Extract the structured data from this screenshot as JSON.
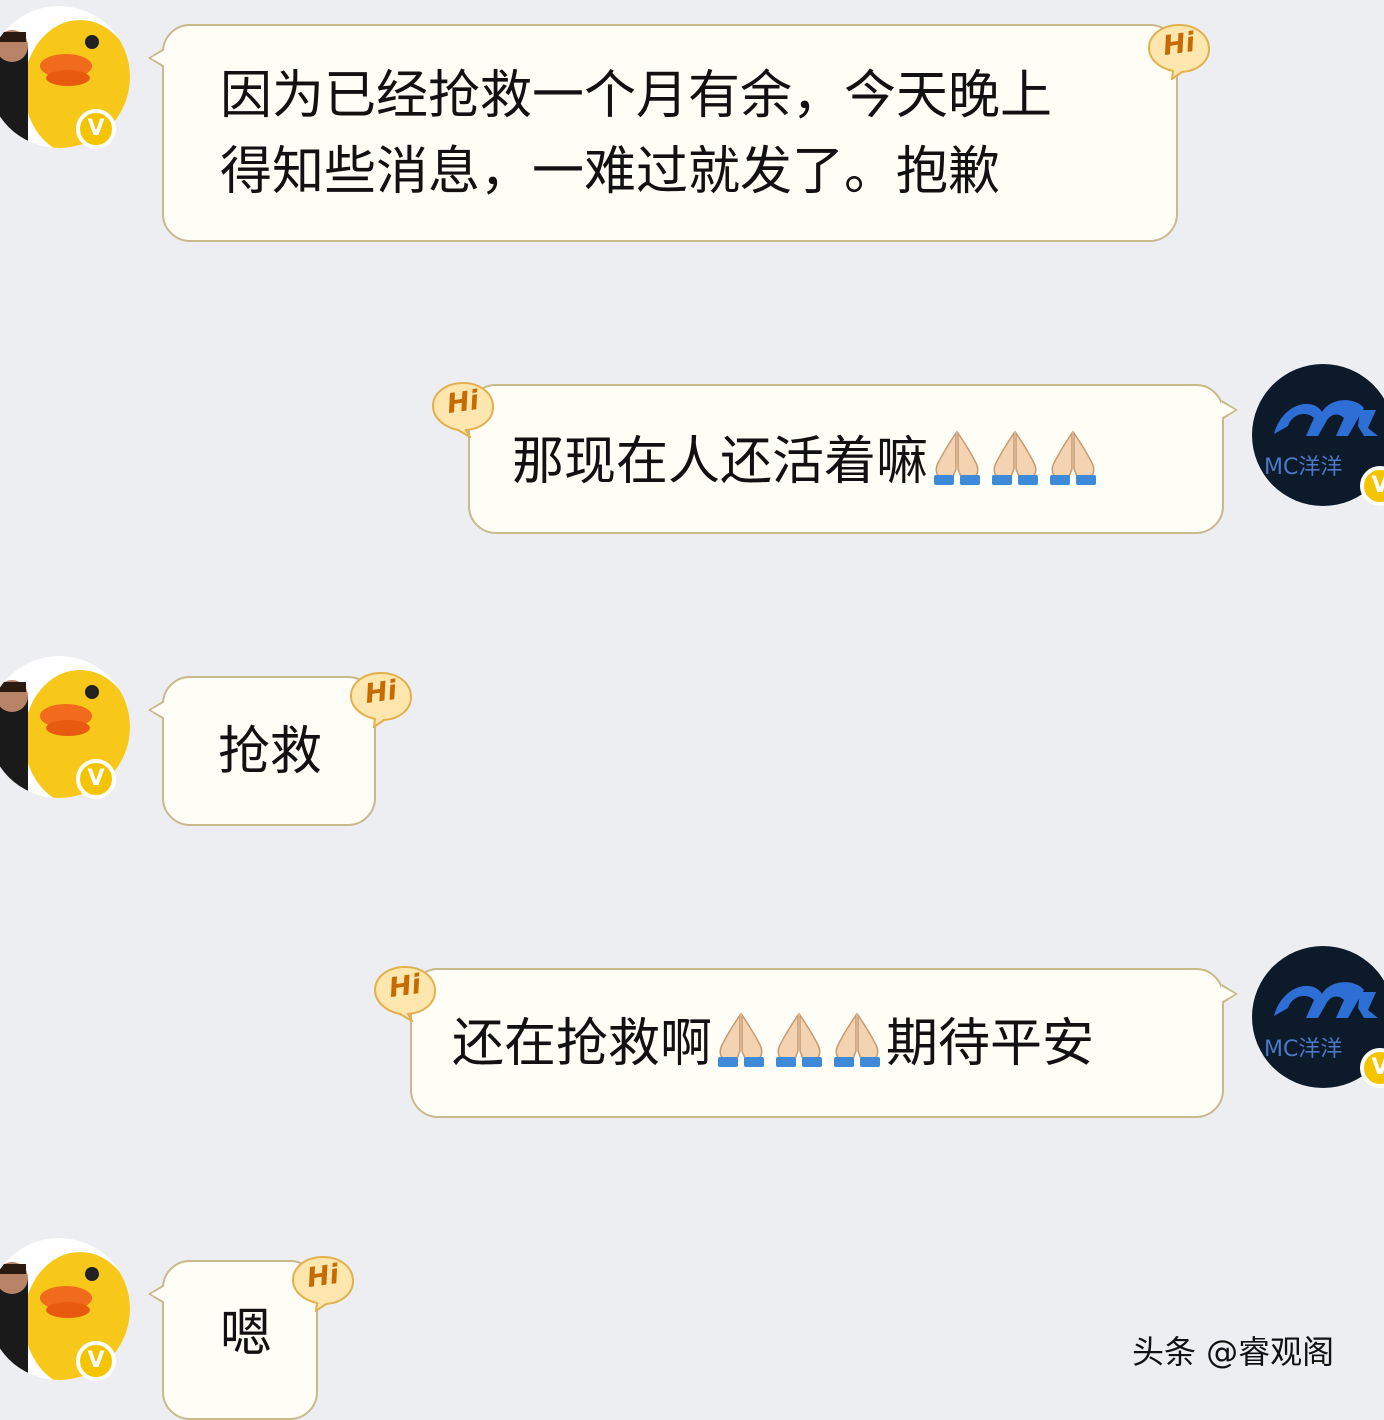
{
  "messages": [
    {
      "side": "left",
      "lines": [
        "因为已经抢救一个月有余，今天晚上",
        "得知些消息，一难过就发了。抱歉"
      ]
    },
    {
      "side": "right",
      "text": "那现在人还活着嘛",
      "emoji": "folded-hands-icon"
    },
    {
      "side": "left",
      "text": "抢救"
    },
    {
      "side": "right",
      "text_before": "还在抢救啊",
      "text_after": "期待平安",
      "emoji": "folded-hands-icon"
    },
    {
      "side": "left",
      "text": "嗯"
    }
  ],
  "badges": {
    "hi_label": "Hi",
    "verified_mark": "V"
  },
  "avatars": {
    "left_icon": "rubber-duck-avatar",
    "right_icon": "logo-avatar",
    "right_logo_text": "MC洋洋"
  },
  "watermark": {
    "text": "头条 @睿观阁"
  },
  "colors": {
    "background": "#eceef2",
    "bubble_fill": "#fefdf6",
    "bubble_border": "#c9b98d",
    "hi_fill": "#fde7ae",
    "hi_text": "#c66b00",
    "verified": "#f5c400",
    "duck_yellow": "#f7c81a",
    "right_avatar_bg": "#0c1a2a",
    "right_logo_blue": "#2e6fd6"
  }
}
